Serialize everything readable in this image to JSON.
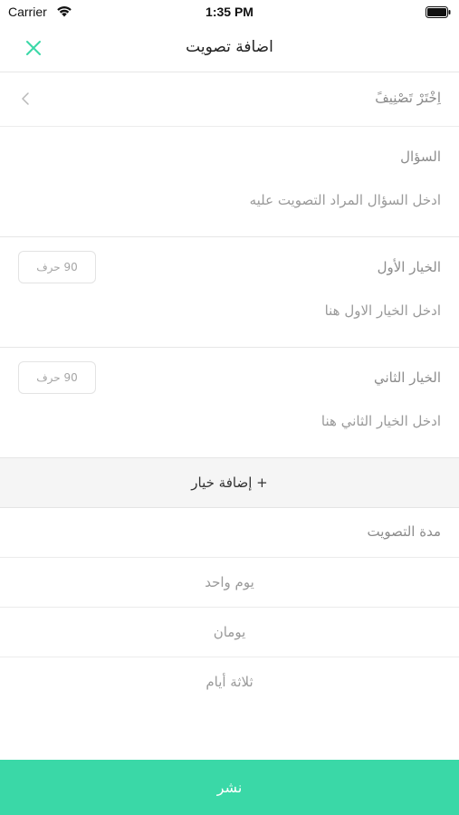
{
  "status_bar": {
    "carrier": "Carrier",
    "time": "1:35 PM",
    "wifi_icon": "wifi-icon",
    "battery_icon": "battery-icon"
  },
  "nav": {
    "title": "اضافة تصويت",
    "close_icon": "close-icon",
    "accent_color": "#3ad8a7"
  },
  "category": {
    "label": "اِخْتَرْ تَصْنِيفً",
    "chevron_icon": "chevron-left-icon"
  },
  "question": {
    "label": "السؤال",
    "placeholder": "ادخل السؤال المراد التصويت عليه"
  },
  "options": [
    {
      "label": "الخيار الأول",
      "placeholder": "ادخل الخيار الاول هنا",
      "char_limit": "90 حرف"
    },
    {
      "label": "الخيار الثاني",
      "placeholder": "ادخل الخيار الثاني هنا",
      "char_limit": "90 حرف"
    }
  ],
  "add_option": {
    "label": "+ إضافة خيار"
  },
  "duration": {
    "label": "مدة التصويت",
    "choices": [
      "يوم واحد",
      "يومان",
      "ثلاثة أيام"
    ]
  },
  "publish": {
    "label": "نشر",
    "color": "#3ad8a7"
  }
}
